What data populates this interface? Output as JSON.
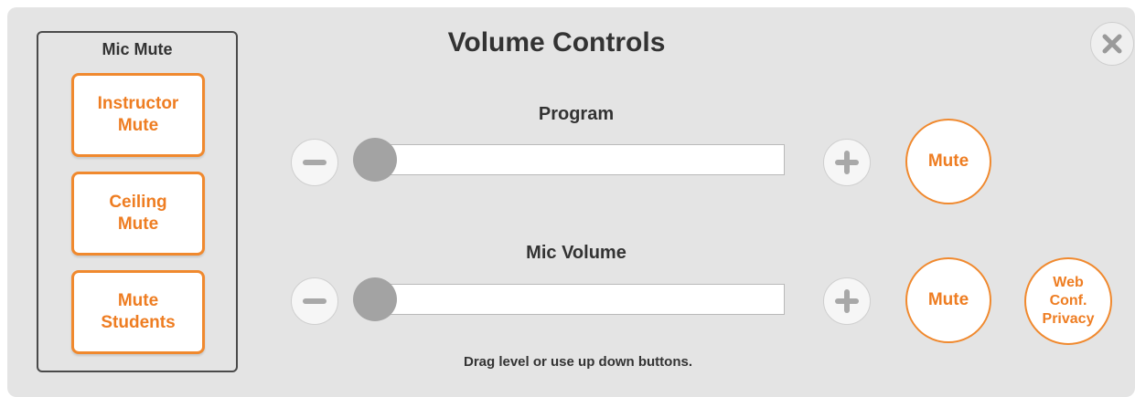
{
  "title": "Volume Controls",
  "mic_mute": {
    "heading": "Mic Mute",
    "buttons": [
      {
        "label": "Instructor\nMute"
      },
      {
        "label": "Ceiling\nMute"
      },
      {
        "label": "Mute\nStudents"
      }
    ]
  },
  "program": {
    "label": "Program",
    "level": 0,
    "mute_label": "Mute"
  },
  "mic_volume": {
    "label": "Mic Volume",
    "level": 0,
    "mute_label": "Mute"
  },
  "web_conf_privacy_label": "Web\nConf.\nPrivacy",
  "hint": "Drag level or use up down buttons.",
  "icons": {
    "minus": "minus-icon",
    "plus": "plus-icon",
    "close": "close-icon"
  },
  "colors": {
    "accent": "#f0892e",
    "panel": "#e4e4e4",
    "knob": "#a3a3a3"
  }
}
